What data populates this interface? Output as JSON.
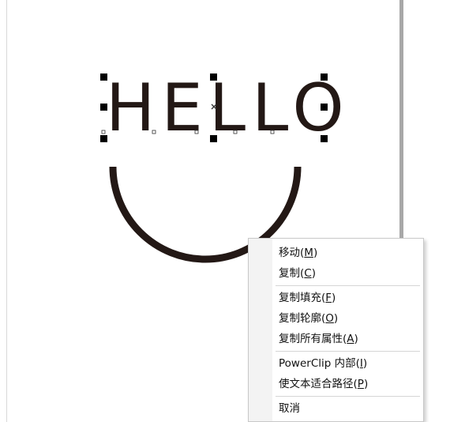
{
  "canvas": {
    "text_object": "HELLO",
    "colors": {
      "ink": "#231815",
      "handle": "#000000",
      "page_shadow": "#a8a8a8"
    }
  },
  "context_menu": {
    "items": [
      {
        "label": "移动",
        "accel_open": "(",
        "accel": "M",
        "accel_close": ")"
      },
      {
        "label": "复制",
        "accel_open": "(",
        "accel": "C",
        "accel_close": ")"
      },
      {
        "label": "复制填充",
        "accel_open": "(",
        "accel": "F",
        "accel_close": ")"
      },
      {
        "label": "复制轮廓",
        "accel_open": "(",
        "accel": "O",
        "accel_close": ")"
      },
      {
        "label": "复制所有属性",
        "accel_open": "(",
        "accel": "A",
        "accel_close": ")"
      },
      {
        "label": "PowerClip 内部",
        "accel_open": "(",
        "accel": "I",
        "accel_close": ")"
      },
      {
        "label": "使文本适合路径",
        "accel_open": "(",
        "accel": "P",
        "accel_close": ")"
      },
      {
        "label": "取消",
        "accel_open": "",
        "accel": "",
        "accel_close": ""
      }
    ]
  }
}
